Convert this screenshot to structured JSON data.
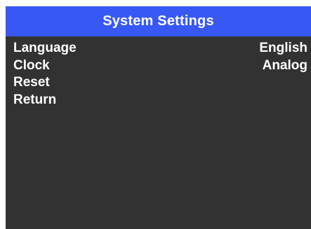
{
  "title": "System Settings",
  "menu": {
    "items": [
      {
        "label": "Language",
        "value": "English"
      },
      {
        "label": "Clock",
        "value": "Analog"
      },
      {
        "label": "Reset",
        "value": ""
      },
      {
        "label": "Return",
        "value": ""
      }
    ]
  },
  "colors": {
    "title_bar": "#3858f5",
    "background": "#323232",
    "text": "#ffffff"
  }
}
